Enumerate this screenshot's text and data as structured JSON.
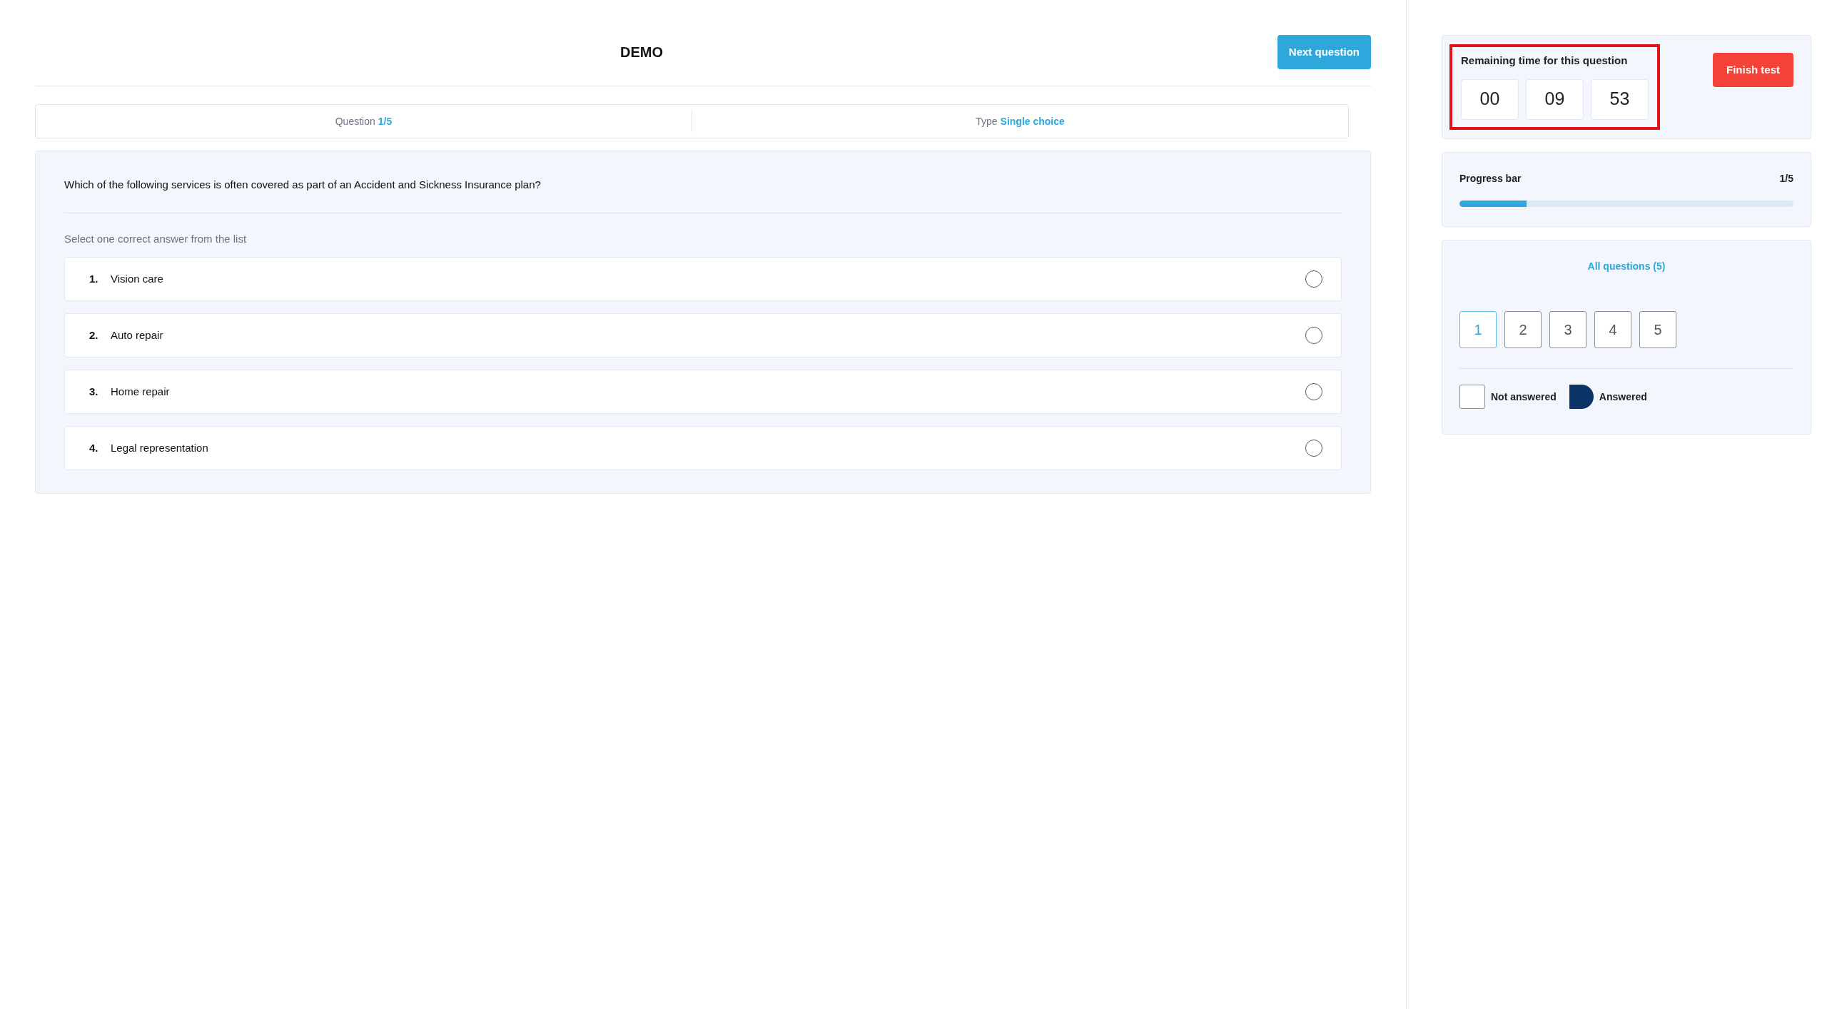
{
  "header": {
    "title": "DEMO",
    "next_button": "Next question"
  },
  "info_bar": {
    "question_label": "Question",
    "question_value": "1/5",
    "type_label": "Type",
    "type_value": "Single choice"
  },
  "question": {
    "text": "Which of the following services is often covered as part of an Accident and Sickness Insurance plan?",
    "instruction": "Select one correct answer from the list",
    "options": [
      {
        "number": "1.",
        "label": "Vision care",
        "selected": false
      },
      {
        "number": "2.",
        "label": "Auto repair",
        "selected": false
      },
      {
        "number": "3.",
        "label": "Home repair",
        "selected": false
      },
      {
        "number": "4.",
        "label": "Legal representation",
        "selected": false
      }
    ]
  },
  "timer": {
    "title": "Remaining time for this question",
    "hours": "00",
    "minutes": "09",
    "seconds": "53",
    "finish_button": "Finish test"
  },
  "progress": {
    "title": "Progress bar",
    "count": "1/5",
    "level": 0.2
  },
  "questions_nav": {
    "title": "All questions (5)",
    "items": [
      {
        "label": "1",
        "selected": true,
        "answered": false
      },
      {
        "label": "2",
        "selected": false,
        "answered": false
      },
      {
        "label": "3",
        "selected": false,
        "answered": false
      },
      {
        "label": "4",
        "selected": false,
        "answered": false
      },
      {
        "label": "5",
        "selected": false,
        "answered": false
      }
    ],
    "legend": [
      {
        "kind": "empty",
        "label": "Not answered"
      },
      {
        "kind": "filled",
        "label": "Answered"
      }
    ]
  }
}
